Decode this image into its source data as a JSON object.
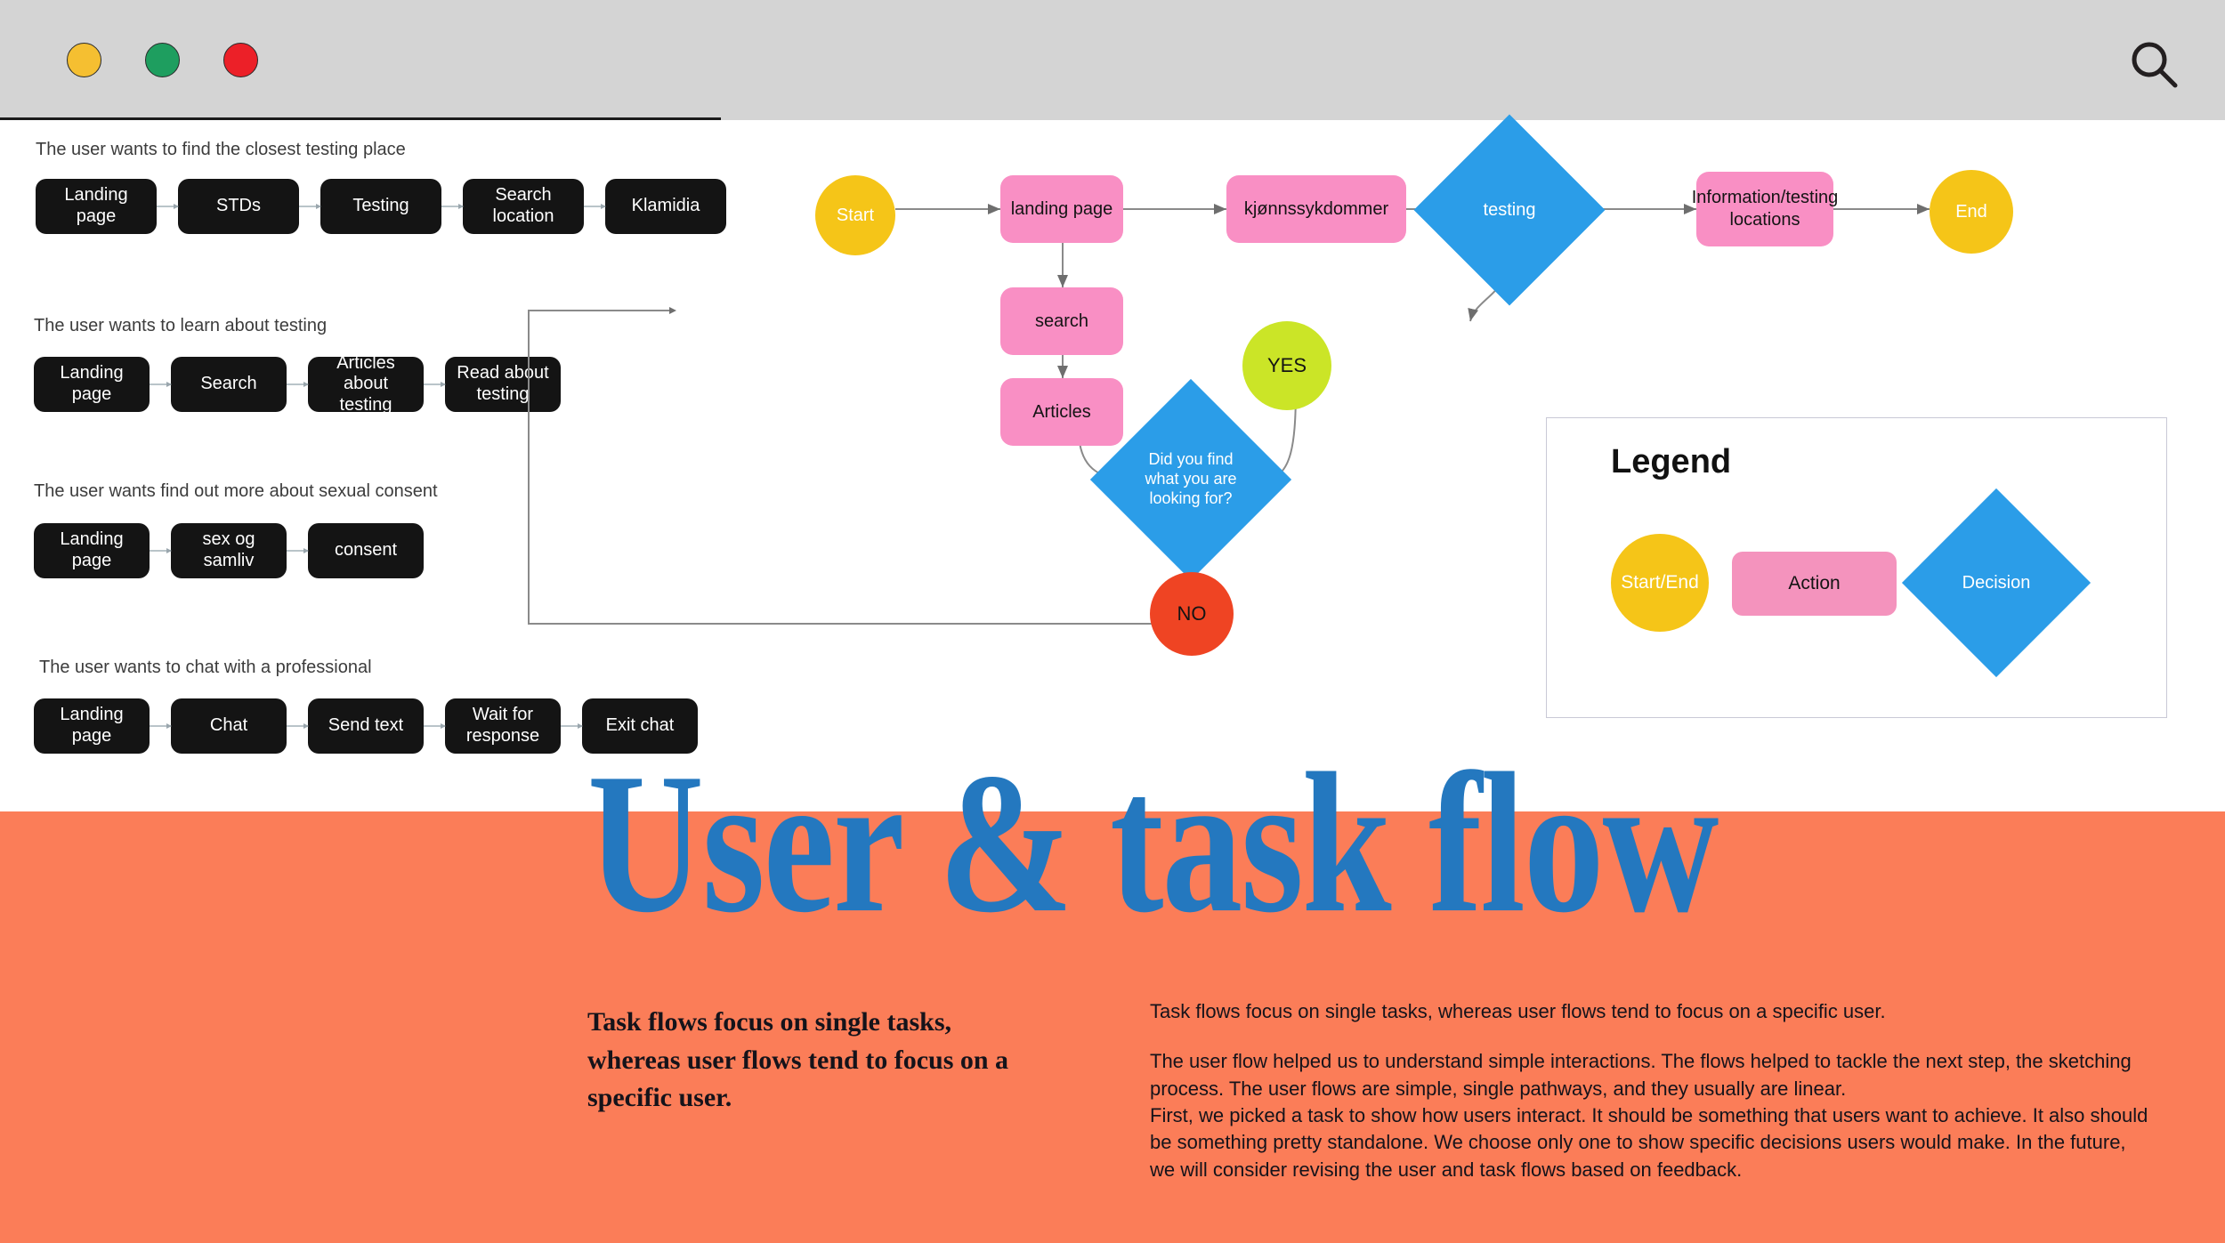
{
  "window": {
    "traffic_lights": [
      {
        "name": "minimize",
        "color": "#f5bf31"
      },
      {
        "name": "maximize",
        "color": "#1e9e5f"
      },
      {
        "name": "close",
        "color": "#ec2028"
      }
    ],
    "search_icon": "search-icon",
    "chrome_color": "#d4d4d4"
  },
  "task_flows": [
    {
      "caption": "The user wants to find the closest testing place",
      "steps": [
        "Landing page",
        "STDs",
        "Testing",
        "Search location",
        "Klamidia"
      ]
    },
    {
      "caption": "The user wants to learn about testing",
      "steps": [
        "Landing page",
        "Search",
        "Articles about testing",
        "Read about testing"
      ]
    },
    {
      "caption": "The user wants find out more about sexual consent",
      "steps": [
        "Landing page",
        "sex og samliv",
        "consent"
      ]
    },
    {
      "caption": "The user wants to chat with a professional",
      "steps": [
        "Landing page",
        "Chat",
        "Send text",
        "Wait for response",
        "Exit chat"
      ]
    }
  ],
  "user_flow": {
    "nodes": {
      "start": "Start",
      "landing_page": "landing page",
      "kjonnssykdommer": "kjønnssykdommer",
      "testing": "testing",
      "info_locations": "Information/testing locations",
      "end": "End",
      "search": "search",
      "articles": "Articles",
      "decision": "Did you find what you are looking for?",
      "yes": "YES",
      "no": "NO"
    },
    "colors": {
      "terminator": "#f5c518",
      "action": "#f98fc4",
      "decision": "#2b9de8",
      "yes": "#cbe527",
      "no": "#ef4423",
      "connector": "#8a8a8a"
    }
  },
  "legend": {
    "title": "Legend",
    "items": [
      {
        "label": "Start/End",
        "shape": "ellipse",
        "color": "#f5c518"
      },
      {
        "label": "Action",
        "shape": "rounded-rect",
        "color": "#f493bd"
      },
      {
        "label": "Decision",
        "shape": "diamond",
        "color": "#2b9de8"
      }
    ]
  },
  "footer": {
    "title": "User  & task flow",
    "title_color": "#2478bf",
    "band_color": "#fb7d58",
    "lede": "Task flows focus on single tasks, whereas user flows tend to focus on a specific user.",
    "paragraph_1": "Task flows focus on single tasks, whereas user flows tend to focus on a specific user.",
    "paragraph_2": "The user flow helped us to understand simple interactions. The flows helped to tackle the next step, the sketching process. The user flows are simple, single pathways, and they usually are linear.",
    "paragraph_3": "First, we picked a task to show how users interact. It should be something that users want to achieve. It also should be something pretty standalone. We choose only one to show specific decisions users would make. In the future, we will consider revising the user and task flows based on feedback."
  }
}
